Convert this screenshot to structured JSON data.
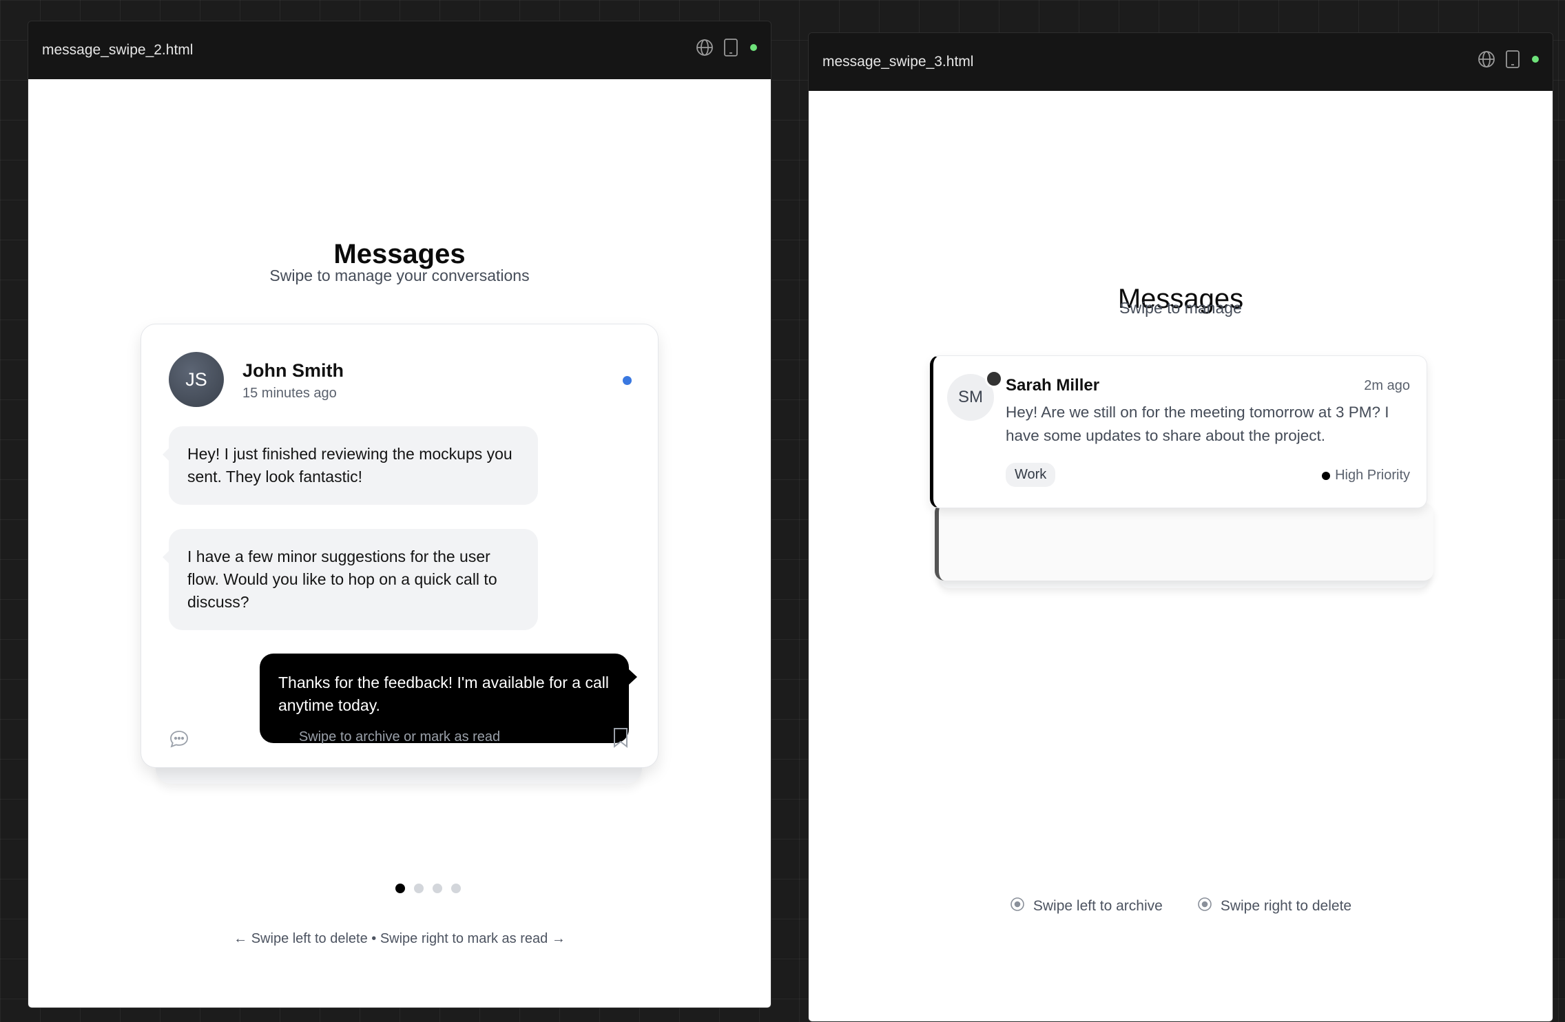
{
  "windows": [
    {
      "title": "message_swipe_2.html",
      "header": {
        "title": "Messages",
        "subtitle": "Swipe to manage your conversations"
      },
      "card": {
        "avatar_initials": "JS",
        "name": "John Smith",
        "time": "15 minutes ago",
        "messages": [
          {
            "text": "Hey! I just finished reviewing the mockups you sent. They look fantastic!",
            "direction": "in"
          },
          {
            "text": "I have a few minor suggestions for the user flow. Would you like to hop on a quick call to discuss?",
            "direction": "in"
          },
          {
            "text": "Thanks for the feedback! I'm available for a call anytime today.",
            "direction": "out"
          }
        ],
        "footer_hint": "Swipe to archive or mark as read"
      },
      "pagination": {
        "total": 4,
        "active": 1
      },
      "hint": "← Swipe left to delete • Swipe right to mark as read →"
    },
    {
      "title": "message_swipe_3.html",
      "header": {
        "title": "Messages",
        "subtitle": "Swipe to manage"
      },
      "card": {
        "avatar_initials": "SM",
        "name": "Sarah Miller",
        "time": "2m ago",
        "preview": "Hey! Are we still on for the meeting tomorrow at 3 PM? I have some updates to share about the project.",
        "tag": "Work",
        "priority": "High Priority"
      },
      "legend": [
        "Swipe left to archive",
        "Swipe right to delete"
      ]
    }
  ],
  "colors": {
    "unread_dot": "#3a78e0",
    "live_dot": "#6ee27a",
    "outgoing_bubble": "#000000",
    "incoming_bubble": "#f2f3f5"
  },
  "icons": [
    "globe-icon",
    "tablet-icon",
    "chat-icon",
    "bookmark-icon",
    "target-icon"
  ]
}
